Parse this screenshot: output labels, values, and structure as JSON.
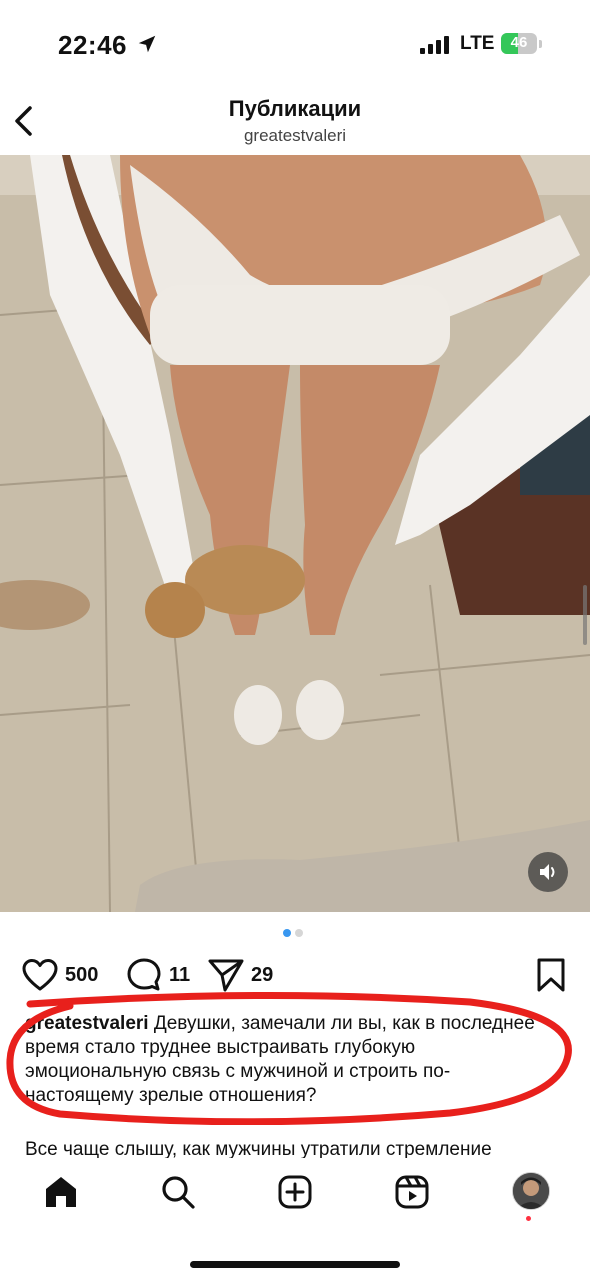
{
  "status_bar": {
    "time": "22:46",
    "network": "LTE",
    "battery": "46",
    "battery_level": 0.46,
    "battery_color": "#34c759"
  },
  "header": {
    "title": "Публикации",
    "username": "greatestvaleri",
    "back_icon": "chevron-left-icon"
  },
  "media": {
    "sound_icon": "speaker-icon",
    "carousel_dots": 2,
    "active_dot": 0,
    "active_dot_color": "#3897f0"
  },
  "actions": {
    "likes": "500",
    "comments": "11",
    "shares": "29",
    "icons": [
      "heart-icon",
      "comment-icon",
      "share-icon",
      "bookmark-icon"
    ]
  },
  "caption": {
    "username": "greatestvaleri",
    "text": " Девушки, замечали ли вы, как в последнее время стало труднее выстраивать глубокую эмоциональную связь с мужчиной и строить по-настоящему зрелые отношения?",
    "continuation": "Все чаще слышу, как мужчины утратили стремление"
  },
  "annotation": {
    "color": "#e8201c"
  },
  "tab_bar": {
    "icons": [
      "home-icon",
      "search-icon",
      "create-icon",
      "reels-icon",
      "profile-avatar"
    ]
  }
}
